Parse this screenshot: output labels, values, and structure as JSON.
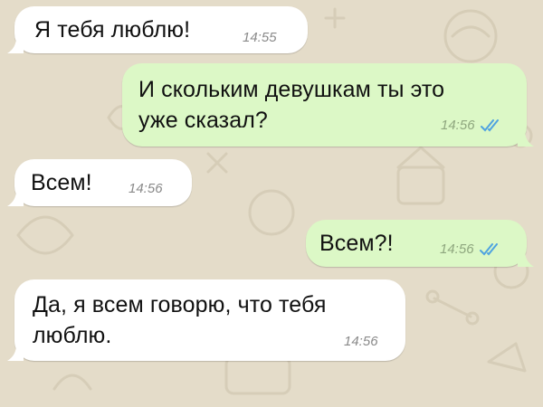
{
  "chat": {
    "messages": [
      {
        "direction": "incoming",
        "text": "Я тебя люблю!",
        "time": "14:55"
      },
      {
        "direction": "outgoing",
        "text_lines": [
          "И скольким девушкам ты это",
          "уже сказал?"
        ],
        "time": "14:56",
        "status": "read"
      },
      {
        "direction": "incoming",
        "text": "Всем!",
        "time": "14:56"
      },
      {
        "direction": "outgoing",
        "text": "Всем?!",
        "time": "14:56",
        "status": "read"
      },
      {
        "direction": "incoming",
        "text_lines": [
          "Да, я всем говорю, что тебя",
          "люблю."
        ],
        "time": "14:56"
      }
    ]
  },
  "colors": {
    "background": "#e4dcc9",
    "incoming_bubble": "#ffffff",
    "outgoing_bubble": "#dcf8c6",
    "read_check": "#4fa3e0"
  },
  "icons": [
    "double-check-icon"
  ]
}
